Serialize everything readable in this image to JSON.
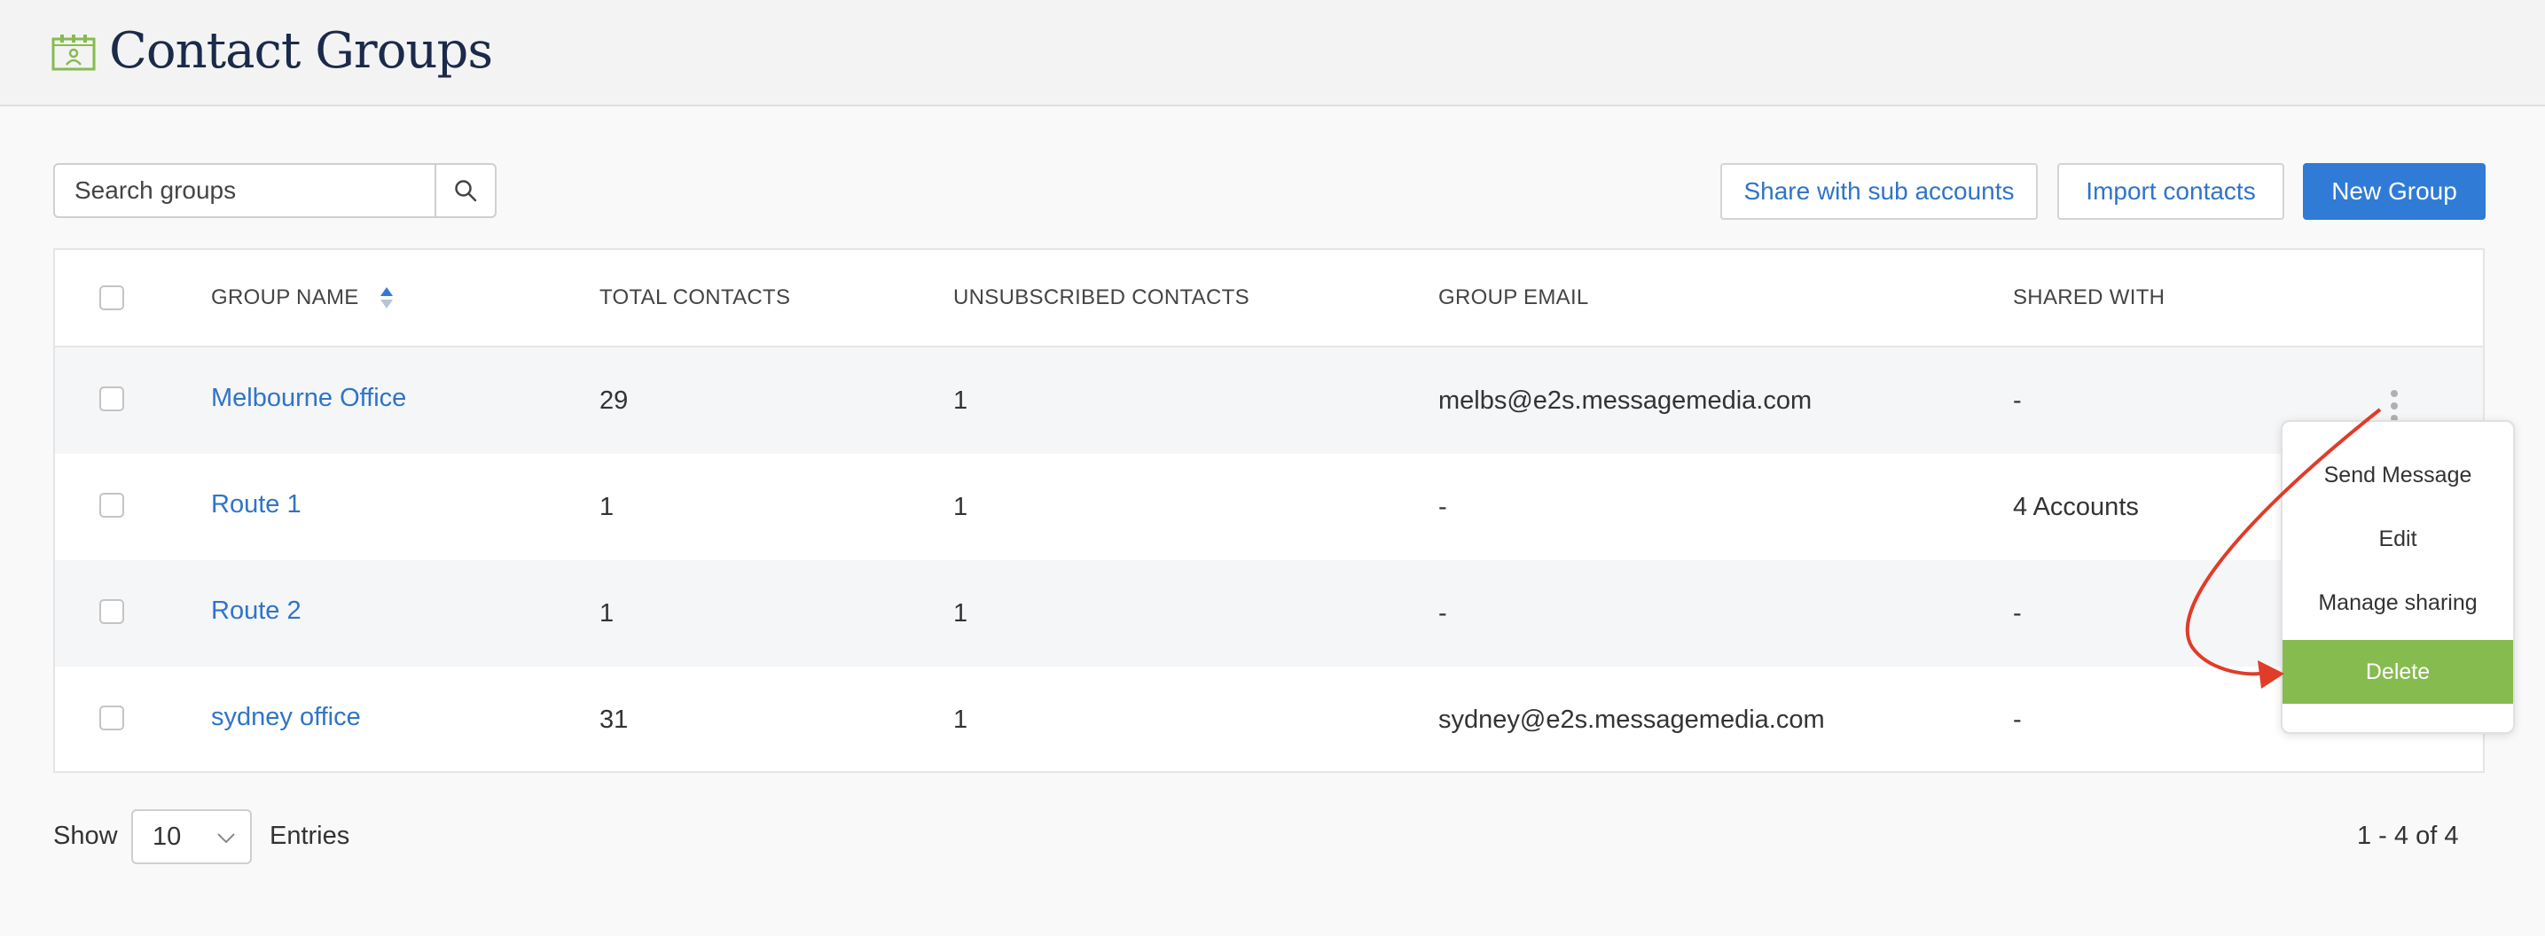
{
  "page": {
    "title": "Contact Groups",
    "icon": "contact-book-icon"
  },
  "toolbar": {
    "search_placeholder": "Search groups",
    "search_icon": "search-icon",
    "share_label": "Share with sub accounts",
    "import_label": "Import contacts",
    "new_label": "New Group"
  },
  "table": {
    "columns": {
      "name": "GROUP NAME",
      "total": "TOTAL CONTACTS",
      "unsub": "UNSUBSCRIBED CONTACTS",
      "email": "GROUP EMAIL",
      "shared": "SHARED WITH"
    },
    "sort_icon": "sort-icon",
    "rows": [
      {
        "name": "Melbourne Office",
        "total": "29",
        "unsub": "1",
        "email": "melbs@e2s.messagemedia.com",
        "shared": "-"
      },
      {
        "name": "Route 1",
        "total": "1",
        "unsub": "1",
        "email": "-",
        "shared": "4 Accounts"
      },
      {
        "name": "Route 2",
        "total": "1",
        "unsub": "1",
        "email": "-",
        "shared": "-"
      },
      {
        "name": "sydney office",
        "total": "31",
        "unsub": "1",
        "email": "sydney@e2s.messagemedia.com",
        "shared": "-"
      }
    ]
  },
  "row_menu": {
    "icon": "more-vertical-icon",
    "items": [
      "Send Message",
      "Edit",
      "Manage sharing",
      "Delete"
    ],
    "highlight_color": "#86bb50"
  },
  "annotation": {
    "arrow_color": "#e03c28"
  },
  "footer": {
    "show_label": "Show",
    "page_size": "10",
    "entries_label": "Entries",
    "range": "1 - 4 of 4"
  },
  "colors": {
    "primary": "#2f7bd6",
    "link": "#2f74c7",
    "title": "#1b2a4a",
    "icon": "#86bb50"
  }
}
